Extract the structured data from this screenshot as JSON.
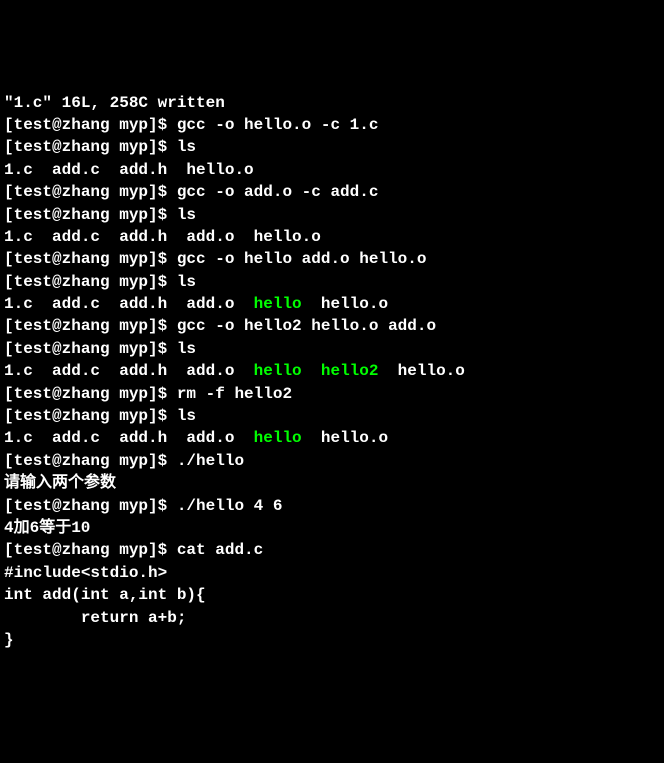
{
  "lines": [
    {
      "type": "out",
      "segments": [
        {
          "text": "\"1.c\" 16L, 258C written",
          "cls": "out"
        }
      ]
    },
    {
      "type": "prompt",
      "prompt": "[test@zhang myp]$ ",
      "cmd": "gcc -o hello.o -c 1.c"
    },
    {
      "type": "prompt",
      "prompt": "[test@zhang myp]$ ",
      "cmd": "ls"
    },
    {
      "type": "out",
      "segments": [
        {
          "text": "1.c  add.c  add.h  hello.o",
          "cls": "out"
        }
      ]
    },
    {
      "type": "prompt",
      "prompt": "[test@zhang myp]$ ",
      "cmd": "gcc -o add.o -c add.c"
    },
    {
      "type": "prompt",
      "prompt": "[test@zhang myp]$ ",
      "cmd": "ls"
    },
    {
      "type": "out",
      "segments": [
        {
          "text": "1.c  add.c  add.h  add.o  hello.o",
          "cls": "out"
        }
      ]
    },
    {
      "type": "prompt",
      "prompt": "[test@zhang myp]$ ",
      "cmd": "gcc -o hello add.o hello.o"
    },
    {
      "type": "prompt",
      "prompt": "[test@zhang myp]$ ",
      "cmd": "ls"
    },
    {
      "type": "out",
      "segments": [
        {
          "text": "1.c  add.c  add.h  add.o  ",
          "cls": "out"
        },
        {
          "text": "hello",
          "cls": "exec"
        },
        {
          "text": "  hello.o",
          "cls": "out"
        }
      ]
    },
    {
      "type": "prompt",
      "prompt": "[test@zhang myp]$ ",
      "cmd": "gcc -o hello2 hello.o add.o"
    },
    {
      "type": "prompt",
      "prompt": "[test@zhang myp]$ ",
      "cmd": "ls"
    },
    {
      "type": "out",
      "segments": [
        {
          "text": "1.c  add.c  add.h  add.o  ",
          "cls": "out"
        },
        {
          "text": "hello",
          "cls": "exec"
        },
        {
          "text": "  ",
          "cls": "out"
        },
        {
          "text": "hello2",
          "cls": "exec"
        },
        {
          "text": "  hello.o",
          "cls": "out"
        }
      ]
    },
    {
      "type": "prompt",
      "prompt": "[test@zhang myp]$ ",
      "cmd": "rm -f hello2"
    },
    {
      "type": "prompt",
      "prompt": "[test@zhang myp]$ ",
      "cmd": "ls"
    },
    {
      "type": "out",
      "segments": [
        {
          "text": "1.c  add.c  add.h  add.o  ",
          "cls": "out"
        },
        {
          "text": "hello",
          "cls": "exec"
        },
        {
          "text": "  hello.o",
          "cls": "out"
        }
      ]
    },
    {
      "type": "prompt",
      "prompt": "[test@zhang myp]$ ",
      "cmd": "./hello"
    },
    {
      "type": "out",
      "segments": [
        {
          "text": "请输入两个参数",
          "cls": "out"
        }
      ]
    },
    {
      "type": "prompt",
      "prompt": "[test@zhang myp]$ ",
      "cmd": "./hello 4 6"
    },
    {
      "type": "out",
      "segments": [
        {
          "text": "4加6等于10",
          "cls": "out"
        }
      ]
    },
    {
      "type": "prompt",
      "prompt": "[test@zhang myp]$ ",
      "cmd": "cat add.c"
    },
    {
      "type": "out",
      "segments": [
        {
          "text": "#include<stdio.h>",
          "cls": "out"
        }
      ]
    },
    {
      "type": "out",
      "segments": [
        {
          "text": "int add(int a,int b){",
          "cls": "out"
        }
      ]
    },
    {
      "type": "out",
      "segments": [
        {
          "text": "        return a+b;",
          "cls": "out"
        }
      ]
    },
    {
      "type": "out",
      "segments": [
        {
          "text": "}",
          "cls": "out"
        }
      ]
    }
  ]
}
